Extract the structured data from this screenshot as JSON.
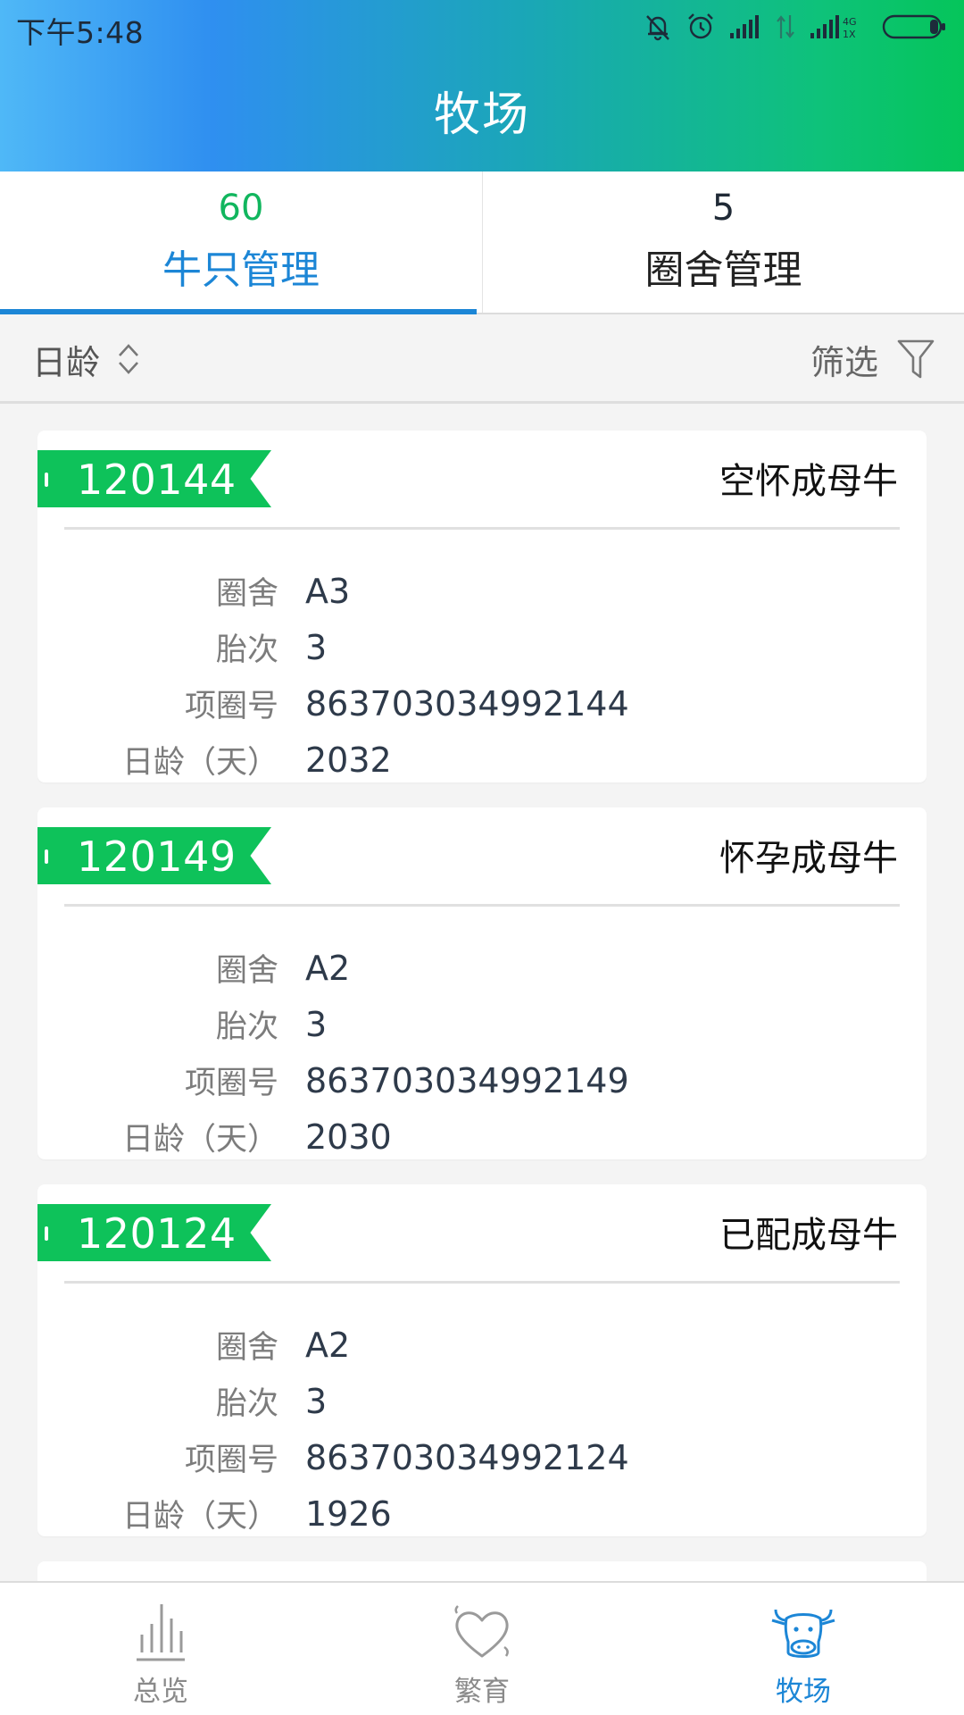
{
  "status_bar": {
    "time": "下午5:48",
    "icons": [
      "bell-off-icon",
      "alarm-icon",
      "signal-icon",
      "data-arrows-icon",
      "signal-4g-icon",
      "battery-icon"
    ],
    "network_label": "4G 1X"
  },
  "header": {
    "title": "牧场",
    "colors": {
      "gradient_start": "#4fb8f7",
      "gradient_end": "#05c55a"
    }
  },
  "tabs": [
    {
      "count": "60",
      "label": "牛只管理",
      "active": true
    },
    {
      "count": "5",
      "label": "圈舍管理",
      "active": false
    }
  ],
  "filter_bar": {
    "sort_label": "日龄",
    "filter_label": "筛选"
  },
  "cards": [
    {
      "id": "120144",
      "status": "空怀成母牛",
      "rows": [
        {
          "label": "圈舍",
          "value": "A3"
        },
        {
          "label": "胎次",
          "value": "3"
        },
        {
          "label": "项圈号",
          "value": "863703034992144"
        },
        {
          "label": "日龄（天）",
          "value": "2032"
        }
      ]
    },
    {
      "id": "120149",
      "status": "怀孕成母牛",
      "rows": [
        {
          "label": "圈舍",
          "value": "A2"
        },
        {
          "label": "胎次",
          "value": "3"
        },
        {
          "label": "项圈号",
          "value": "863703034992149"
        },
        {
          "label": "日龄（天）",
          "value": "2030"
        }
      ]
    },
    {
      "id": "120124",
      "status": "已配成母牛",
      "rows": [
        {
          "label": "圈舍",
          "value": "A2"
        },
        {
          "label": "胎次",
          "value": "3"
        },
        {
          "label": "项圈号",
          "value": "863703034992124"
        },
        {
          "label": "日龄（天）",
          "value": "1926"
        }
      ]
    }
  ],
  "bottom_nav": [
    {
      "label": "总览",
      "icon": "bar-chart-icon",
      "active": false
    },
    {
      "label": "繁育",
      "icon": "heart-icon",
      "active": false
    },
    {
      "label": "牧场",
      "icon": "cow-icon",
      "active": true
    }
  ],
  "colors": {
    "accent_blue": "#1c86d6",
    "accent_green": "#0ec25a",
    "count_green": "#11b65e"
  }
}
